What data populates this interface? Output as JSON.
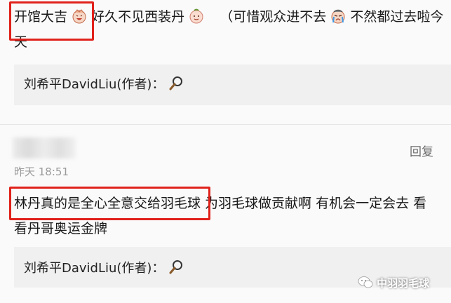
{
  "comment1": {
    "part1": "开馆大吉",
    "part2": "好久不见西装丹",
    "part3": "（可惜观众进不去",
    "part4": "不然都过去啦今",
    "line2": "天",
    "author_reply": "刘希平DavidLiu(作者)："
  },
  "comment2": {
    "time": "昨天 18:51",
    "reply_label": "回复",
    "line1": "林丹真的是全心全意交给羽毛球 为羽毛球做贡献啊 有机会一定会去 看",
    "line2": "看丹哥奥运金牌",
    "author_reply": "刘希平DavidLiu(作者)："
  },
  "watermark": "中羽羽毛球",
  "colors": {
    "highlight_box": "#e0221b",
    "reply_bg": "#f0f0f0"
  },
  "icons": [
    "emoji-laugh-icon",
    "emoji-smile-icon",
    "emoji-cry-icon",
    "magnifier-icon",
    "wechat-icon"
  ]
}
